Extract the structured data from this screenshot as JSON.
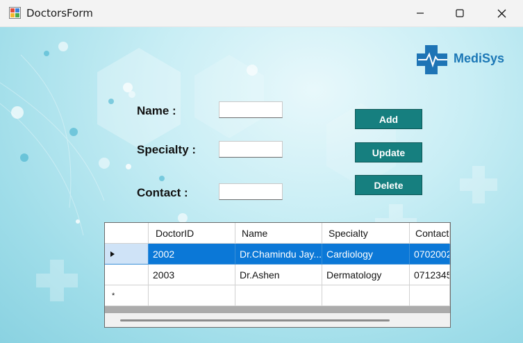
{
  "window": {
    "title": "DoctorsForm"
  },
  "brand": {
    "name": "MediSys"
  },
  "form": {
    "name_label": "Name :",
    "specialty_label": "Specialty :",
    "contact_label": "Contact :",
    "name_value": "",
    "specialty_value": "",
    "contact_value": ""
  },
  "buttons": {
    "add": "Add",
    "update": "Update",
    "delete": "Delete"
  },
  "grid": {
    "columns": [
      "DoctorID",
      "Name",
      "Specialty",
      "Contact"
    ],
    "rows": [
      [
        "2002",
        "Dr.Chamindu Jay...",
        "Cardiology",
        "0702002"
      ],
      [
        "2003",
        "Dr.Ashen",
        "Dermatology",
        "0712345"
      ]
    ],
    "selected_row": 0,
    "new_row_marker": "*"
  },
  "colors": {
    "button_bg": "#167f7f",
    "selection": "#0b78d7",
    "brand": "#1b77b6"
  }
}
